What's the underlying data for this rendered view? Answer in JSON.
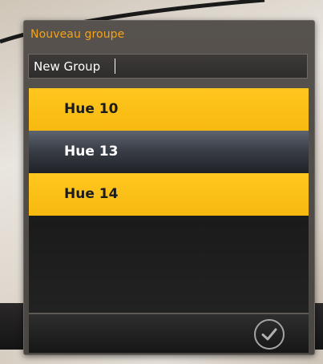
{
  "dialog": {
    "title": "Nouveau groupe",
    "name_field": {
      "value": "New Group",
      "placeholder": ""
    },
    "groups": [
      {
        "label": "Hue 10",
        "selected": true
      },
      {
        "label": "Hue 13",
        "selected": false
      },
      {
        "label": "Hue 14",
        "selected": true
      }
    ],
    "confirm_icon": "check-circle-icon"
  },
  "colors": {
    "accent_orange": "#f3a21b",
    "selected_yellow": "#ffc71f",
    "panel_dark": "#4d4945"
  }
}
